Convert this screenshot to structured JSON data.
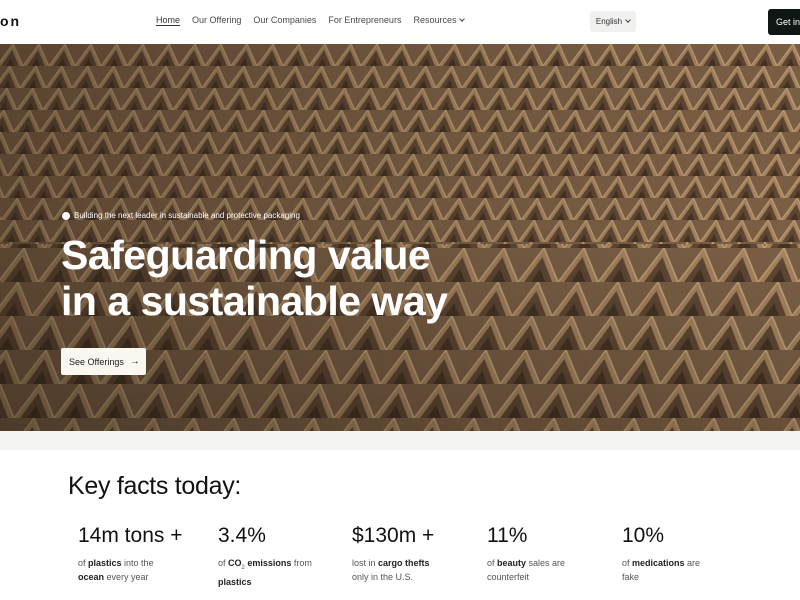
{
  "nav": {
    "logo": "on",
    "links": [
      "Home",
      "Our Offering",
      "Our Companies",
      "For Entrepreneurs",
      "Resources"
    ],
    "language": "English",
    "cta": "Get in"
  },
  "hero": {
    "tagline": "Building the next leader in sustainable and protective packaging",
    "headline_line1": "Safeguarding value",
    "headline_line2": "in a sustainable way",
    "button": "See Offerings"
  },
  "facts": {
    "title": "Key facts today:",
    "items": [
      {
        "value": "14m tons +",
        "d1": "of ",
        "b1": "plastics",
        "d2": " into the",
        "b2": "ocean",
        "d3": " every year"
      },
      {
        "value": "3.4%",
        "d1": "of ",
        "b1": "CO",
        "sub": "2",
        "b1b": " emissions",
        "d2": " from",
        "b2": "plastics",
        "d3": ""
      },
      {
        "value": "$130m +",
        "d1": "lost in ",
        "b1": "cargo thefts",
        "d2": "",
        "b2": "",
        "d3": "only in the U.S."
      },
      {
        "value": "11%",
        "d1": "of ",
        "b1": "beauty",
        "d2": " sales are",
        "b2": "",
        "d3": "counterfeit"
      },
      {
        "value": "10%",
        "d1": "of ",
        "b1": "medications",
        "d2": " are",
        "b2": "",
        "d3": "fake"
      }
    ]
  },
  "icons": {
    "language_chevron": "chevron-down-icon",
    "resources_chevron": "chevron-down-icon",
    "button_arrow": "arrow-right-icon",
    "tagline_dot": "dot-icon"
  }
}
